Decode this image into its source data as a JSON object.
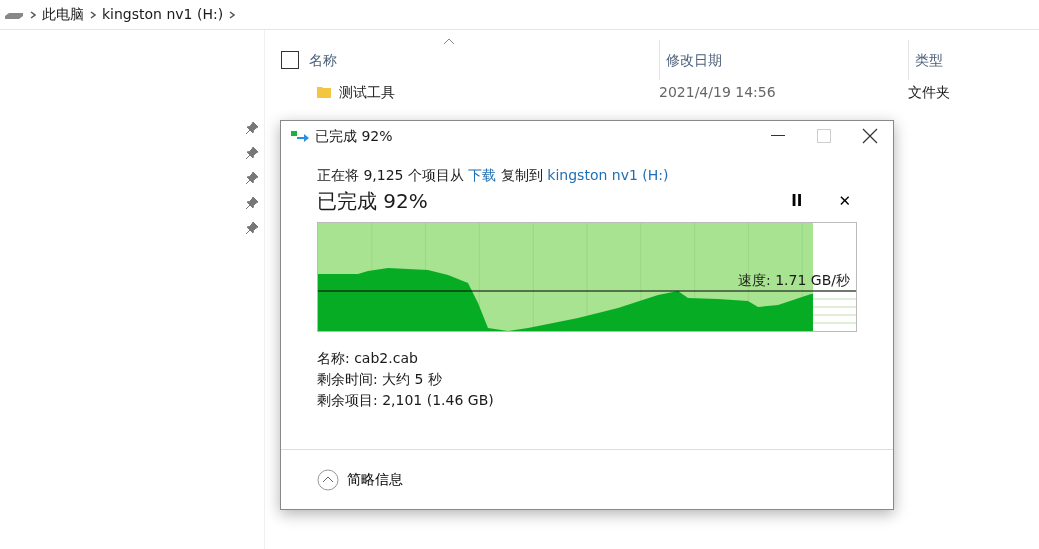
{
  "breadcrumb": [
    "此电脑",
    "kingston nv1 (H:)"
  ],
  "pins": [
    {
      "kind": "pin"
    },
    {
      "kind": "pin"
    },
    {
      "kind": "pin"
    },
    {
      "kind": "pin"
    },
    {
      "kind": "pin"
    }
  ],
  "select_all_checked": false,
  "file_list": {
    "columns": [
      "名称",
      "修改日期",
      "类型"
    ],
    "rows": [
      {
        "name": "测试工具",
        "modified": "2021/4/19 14:56",
        "type": "文件夹"
      }
    ]
  },
  "dialog": {
    "title": "已完成 92%",
    "description": {
      "prefix": "正在将 9,125 个项目从",
      "source": "下载",
      "middle": "复制到",
      "destination": "kingston nv1 (H:)"
    },
    "heading": "已完成 92%",
    "pause": "II",
    "cancel": "✕",
    "progress": {
      "level": 0.92
    },
    "speed": "速度: 1.71 GB/秒",
    "details": [
      "名称: cab2.cab",
      "剩余时间: 大约 5 秒",
      "剩余项目: 2,101 (1.46 GB)"
    ],
    "toggle": {
      "label": "简略信息",
      "expanded": true
    }
  }
}
